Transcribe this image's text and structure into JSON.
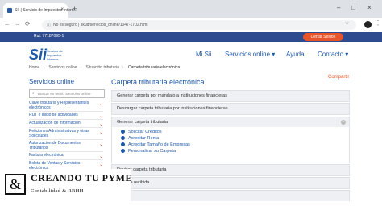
{
  "browser": {
    "tab_title": "SII | Servicio de Impuestos Intern...",
    "new_tab": "+",
    "tab_close": "×",
    "address_security": "No es seguro",
    "address_url": "skud/servicios_online/1047-1702.html",
    "window_controls": [
      "–",
      "□",
      "×"
    ]
  },
  "topbar": {
    "rut": "Rut: 77187095-1",
    "logout": "Cerrar Sesión"
  },
  "header": {
    "logo_mark": "Sii",
    "logo_text": [
      "Servicio de",
      "Impuestos",
      "Internos"
    ],
    "menu": [
      "Mi Sii",
      "Servicios online ▾",
      "Ayuda",
      "Contacto ▾"
    ]
  },
  "breadcrumb": [
    "Home",
    "Servicios online",
    "Situación tributaria",
    "Carpeta tributaria electrónica"
  ],
  "sidebar": {
    "title": "Servicios online",
    "search_placeholder": "Buscar en menú Servicios online",
    "items": [
      "Clave tributaria y Representantes electrónicos",
      "RUT e Inicio de actividades",
      "Actualización de información",
      "Peticiones Administrativas y otras Solicitudes",
      "Autorización de Documentos Tributarios",
      "Factura electrónica",
      "Boleta de Ventas y Servicios electrónica"
    ]
  },
  "main": {
    "title": "Carpeta tributaria electrónica",
    "share": "Compartir",
    "accordion": [
      "Generar carpeta por mandato a instituciones financieras",
      "Descargar carpeta tributaria por instituciones financieras",
      "Generar carpeta tributaria"
    ],
    "expanded_links": [
      "Solicitar Créditos",
      "Acreditar Renta",
      "Acreditar Tamaño de Empresas",
      "Personalizar su Carpeta"
    ],
    "collapsed_after": [
      "Revisar carpeta tributaria",
      "Carpeta recibida"
    ]
  },
  "overlay": {
    "symbol": "&",
    "title": "CREANDO TU PYME",
    "subtitle": "Contabilidad & RRHH"
  }
}
